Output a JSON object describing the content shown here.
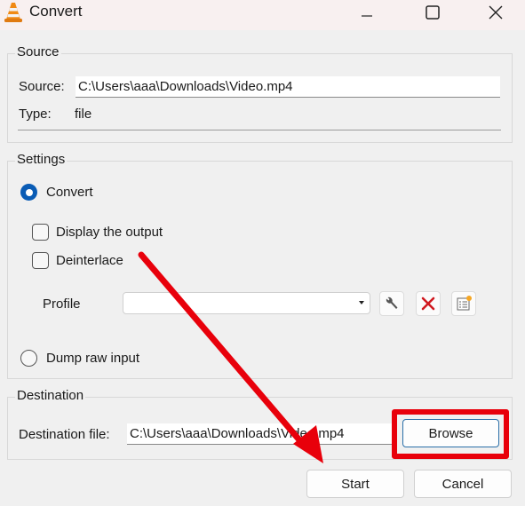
{
  "window": {
    "title": "Convert",
    "icon": "vlc-cone-icon",
    "controls": {
      "minimize": "minimize-icon",
      "maximize": "maximize-icon",
      "close": "close-icon"
    }
  },
  "source": {
    "group_title": "Source",
    "source_label": "Source:",
    "source_value": "C:\\Users\\aaa\\Downloads\\Video.mp4",
    "type_label": "Type:",
    "type_value": "file"
  },
  "settings": {
    "group_title": "Settings",
    "convert_label": "Convert",
    "convert_selected": true,
    "display_output_label": "Display the output",
    "display_output_checked": false,
    "deinterlace_label": "Deinterlace",
    "deinterlace_checked": false,
    "profile_label": "Profile",
    "profile_value": "",
    "profile_tools": [
      "wrench-icon",
      "delete-x-icon",
      "new-profile-icon"
    ],
    "dump_raw_label": "Dump raw input",
    "dump_raw_selected": false
  },
  "destination": {
    "group_title": "Destination",
    "file_label": "Destination file:",
    "file_value": "C:\\Users\\aaa\\Downloads\\Video.mp4",
    "browse_label": "Browse"
  },
  "footer": {
    "start_label": "Start",
    "cancel_label": "Cancel"
  },
  "annotations": {
    "highlight_color": "#e8000b",
    "highlight_target": "Browse",
    "arrow_color": "#e8000b"
  }
}
